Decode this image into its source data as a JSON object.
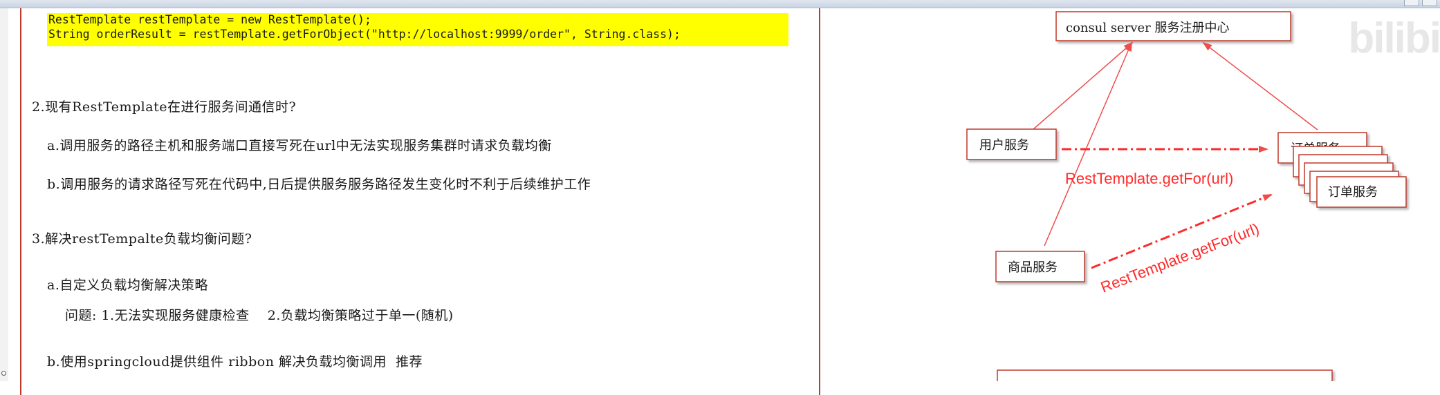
{
  "code": {
    "line1": "RestTemplate restTemplate = new RestTemplate();",
    "line2": "String orderResult = restTemplate.getForObject(\"http://localhost:9999/order\", String.class);"
  },
  "doc": {
    "s2_title": "2.现有RestTemplate在进行服务间通信时?",
    "s2_a": "a.调用服务的路径主机和服务端口直接写死在url中无法实现服务集群时请求负载均衡",
    "s2_b": "b.调用服务的请求路径写死在代码中,日后提供服务服务路径发生变化时不利于后续维护工作",
    "s3_title": "3.解决restTempalte负载均衡问题?",
    "s3_a": "a.自定义负载均衡解决策略",
    "s3_a_problem": "问题: 1.无法实现服务健康检查    2.负载均衡策略过于单一(随机)",
    "s3_b": "b.使用springcloud提供组件 ribbon 解决负载均衡调用  推荐"
  },
  "diagram": {
    "consul": "consul server 服务注册中心",
    "user_service": "用户服务",
    "order_service_back": "订单服务",
    "order_service_front": "订单服务",
    "product_service": "商品服务",
    "arrow1_label": "RestTemplate.getFor(url)",
    "arrow2_label": "RestTemplate.getFor(url)",
    "colors": {
      "line": "#ef4d4d",
      "arrow_text": "#ff2a2a",
      "box_border": "#c0392b"
    }
  },
  "watermark": "bilibi"
}
